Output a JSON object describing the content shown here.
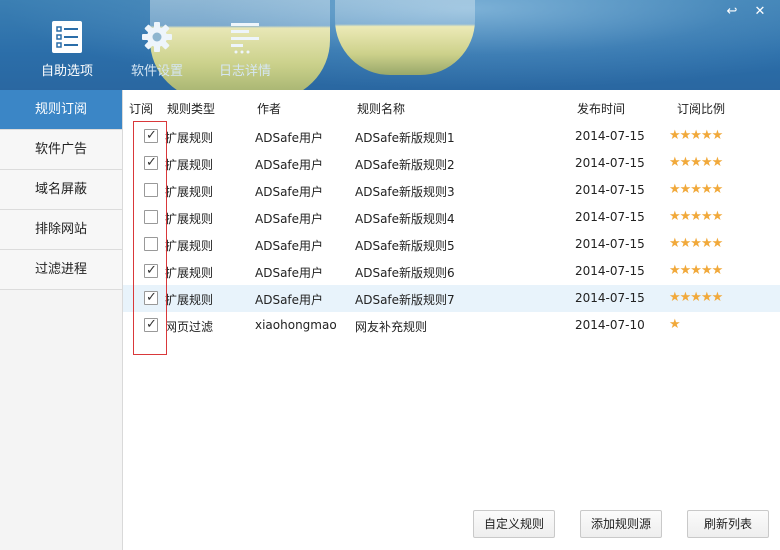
{
  "header": {
    "tools": [
      {
        "label": "自助选项",
        "icon": "list-checklist-icon"
      },
      {
        "label": "软件设置",
        "icon": "gear-icon"
      },
      {
        "label": "日志详情",
        "icon": "log-lines-icon"
      }
    ],
    "controls": {
      "back": "↩",
      "close": "✕"
    }
  },
  "sidebar": {
    "items": [
      {
        "label": "规则订阅",
        "active": true
      },
      {
        "label": "软件广告",
        "active": false
      },
      {
        "label": "域名屏蔽",
        "active": false
      },
      {
        "label": "排除网站",
        "active": false
      },
      {
        "label": "过滤进程",
        "active": false
      }
    ]
  },
  "table": {
    "columns": [
      "订阅",
      "规则类型",
      "作者",
      "规则名称",
      "发布时间",
      "订阅比例"
    ],
    "rows": [
      {
        "checked": true,
        "type": "扩展规则",
        "author": "ADSafe用户",
        "name": "ADSafe新版规则1",
        "date": "2014-07-15",
        "rating": "★★★★★",
        "rating_value": 5
      },
      {
        "checked": true,
        "type": "扩展规则",
        "author": "ADSafe用户",
        "name": "ADSafe新版规则2",
        "date": "2014-07-15",
        "rating": "★★★★★",
        "rating_value": 5
      },
      {
        "checked": false,
        "type": "扩展规则",
        "author": "ADSafe用户",
        "name": "ADSafe新版规则3",
        "date": "2014-07-15",
        "rating": "★★★★★",
        "rating_value": 5
      },
      {
        "checked": false,
        "type": "扩展规则",
        "author": "ADSafe用户",
        "name": "ADSafe新版规则4",
        "date": "2014-07-15",
        "rating": "★★★★★",
        "rating_value": 5
      },
      {
        "checked": false,
        "type": "扩展规则",
        "author": "ADSafe用户",
        "name": "ADSafe新版规则5",
        "date": "2014-07-15",
        "rating": "★★★★★",
        "rating_value": 5
      },
      {
        "checked": true,
        "type": "扩展规则",
        "author": "ADSafe用户",
        "name": "ADSafe新版规则6",
        "date": "2014-07-15",
        "rating": "★★★★★",
        "rating_value": 5
      },
      {
        "checked": true,
        "type": "扩展规则",
        "author": "ADSafe用户",
        "name": "ADSafe新版规则7",
        "date": "2014-07-15",
        "rating": "★★★★★",
        "rating_value": 5,
        "highlight": true
      },
      {
        "checked": true,
        "type": "网页过滤",
        "author": "xiaohongmao",
        "name": "网友补充规则",
        "date": "2014-07-10",
        "rating": "★",
        "rating_value": 1
      }
    ]
  },
  "footer": {
    "custom_rule": "自定义规则",
    "add_source": "添加规则源",
    "refresh_list": "刷新列表"
  },
  "colors": {
    "accent": "#3b86c6",
    "star": "#f1a93b",
    "header": "#2b6ea9"
  }
}
